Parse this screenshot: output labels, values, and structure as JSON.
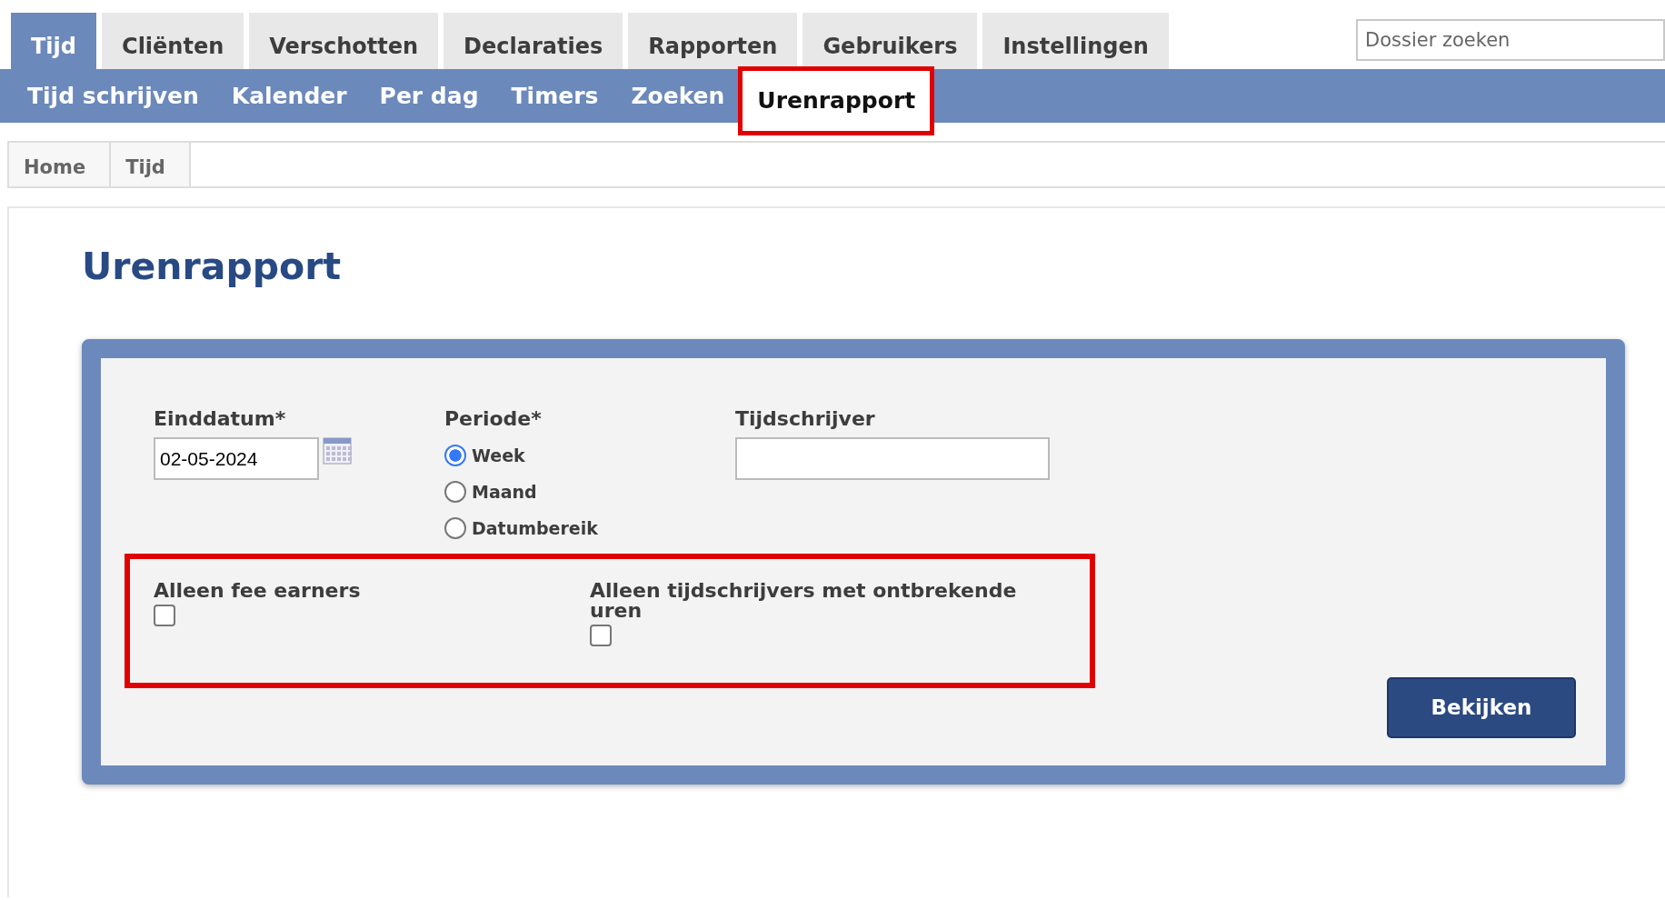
{
  "main_tabs": [
    {
      "label": "Tijd",
      "selected": true
    },
    {
      "label": "Cliënten",
      "selected": false
    },
    {
      "label": "Verschotten",
      "selected": false
    },
    {
      "label": "Declaraties",
      "selected": false
    },
    {
      "label": "Rapporten",
      "selected": false
    },
    {
      "label": "Gebruikers",
      "selected": false
    },
    {
      "label": "Instellingen",
      "selected": false
    }
  ],
  "search": {
    "placeholder": "Dossier zoeken"
  },
  "sub_tabs": [
    {
      "label": "Tijd schrijven",
      "selected": false,
      "highlighted": false
    },
    {
      "label": "Kalender",
      "selected": false,
      "highlighted": false
    },
    {
      "label": "Per dag",
      "selected": false,
      "highlighted": false
    },
    {
      "label": "Timers",
      "selected": false,
      "highlighted": false
    },
    {
      "label": "Zoeken",
      "selected": false,
      "highlighted": false
    },
    {
      "label": "Urenrapport",
      "selected": true,
      "highlighted": true
    }
  ],
  "breadcrumb": [
    "Home",
    "Tijd"
  ],
  "page_title": "Urenrapport",
  "form": {
    "end_date": {
      "label": "Einddatum*",
      "value": "02-05-2024"
    },
    "period": {
      "label": "Periode*",
      "options": [
        {
          "label": "Week",
          "selected": true
        },
        {
          "label": "Maand",
          "selected": false
        },
        {
          "label": "Datumbereik",
          "selected": false
        }
      ]
    },
    "timekeeper": {
      "label": "Tijdschrijver"
    },
    "options_highlighted": true,
    "checkboxes": [
      {
        "label": "Alleen fee earners",
        "checked": false
      },
      {
        "label": "Alleen tijdschrijvers met ontbrekende uren",
        "checked": false
      }
    ],
    "submit": "Bekijken"
  }
}
